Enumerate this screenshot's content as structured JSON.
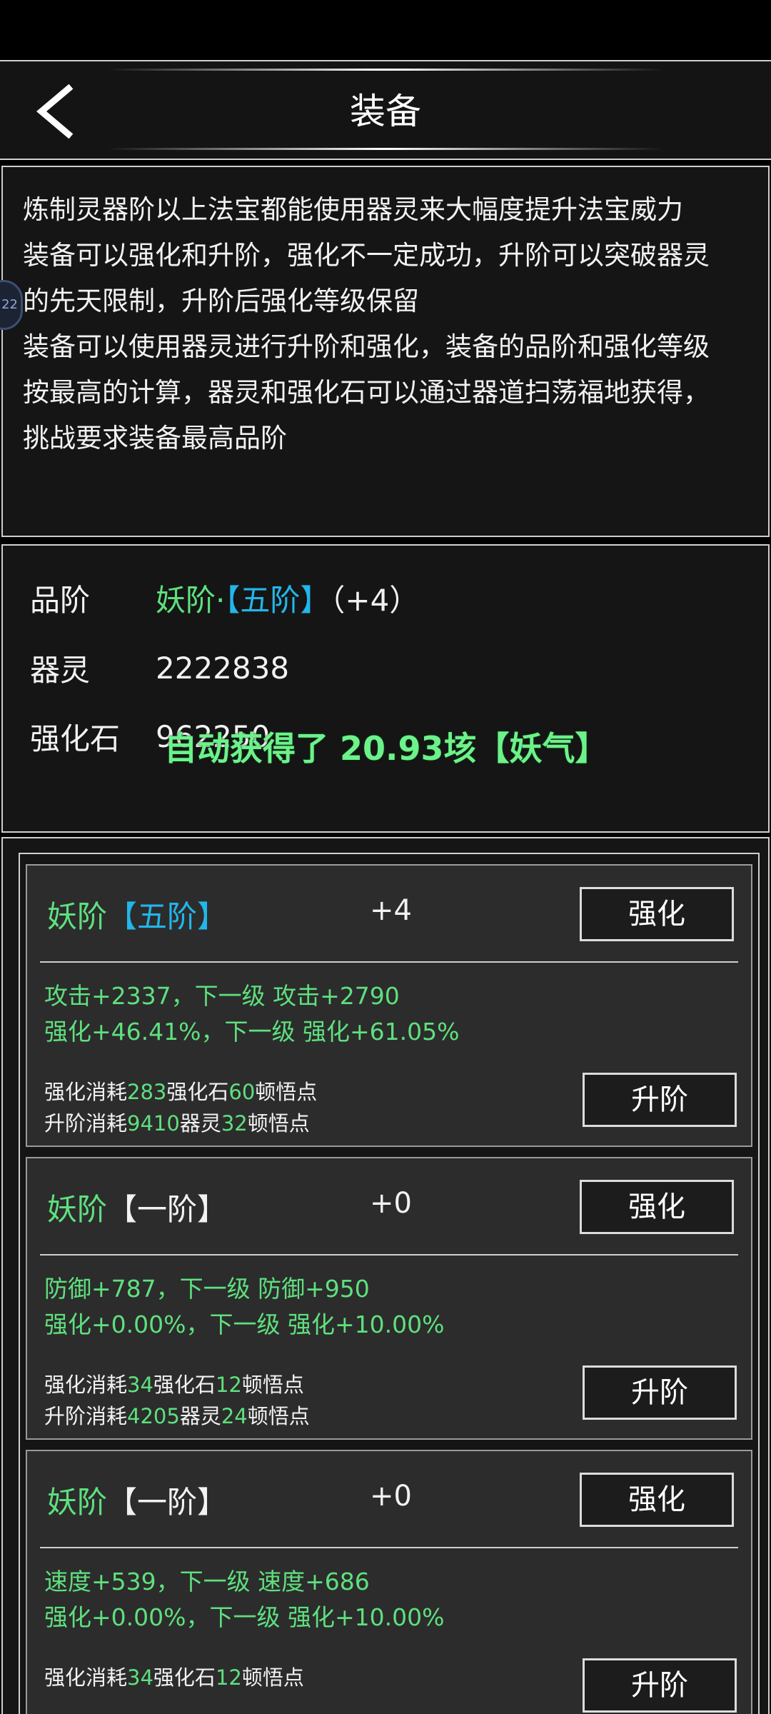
{
  "header": {
    "title": "装备"
  },
  "description": {
    "lines": [
      "炼制灵器阶以上法宝都能使用器灵来大幅度提升法宝威力",
      "装备可以强化和升阶，强化不一定成功，升阶可以突破器灵",
      "的先天限制，升阶后强化等级保留",
      "装备可以使用器灵进行升阶和强化，装备的品阶和强化等级",
      "按最高的计算，器灵和强化石可以通过器道扫荡福地获得，",
      "挑战要求装备最高品阶"
    ]
  },
  "side_badge": {
    "text": "22"
  },
  "stats": {
    "grade_label": "品阶",
    "grade_realm": "妖阶·",
    "grade_tier": "【五阶】",
    "grade_plus": "（+4）",
    "spirit_label": "器灵",
    "spirit_value": "2222838",
    "stone_label": "强化石",
    "stone_value": "962250"
  },
  "toast": {
    "text": "自动获得了 20.93垓【妖气】"
  },
  "cards": [
    {
      "realm": "妖阶",
      "tier": "【五阶】",
      "level": "+4",
      "strengthen_label": "强化",
      "ascend_label": "升阶",
      "attr1": "攻击+2337，下一级 攻击+2790",
      "attr2": "强化+46.41%，下一级 强化+61.05%",
      "cost1": {
        "prefix": "强化消耗",
        "n1": "283",
        "mid": "强化石",
        "n2": "60",
        "suffix": "顿悟点"
      },
      "cost2": {
        "prefix": "升阶消耗",
        "n1": "9410",
        "mid": "器灵",
        "n2": "32",
        "suffix": "顿悟点"
      }
    },
    {
      "realm": "妖阶",
      "tier": "【一阶】",
      "level": "+0",
      "strengthen_label": "强化",
      "ascend_label": "升阶",
      "attr1": "防御+787，下一级 防御+950",
      "attr2": "强化+0.00%，下一级 强化+10.00%",
      "cost1": {
        "prefix": "强化消耗",
        "n1": "34",
        "mid": "强化石",
        "n2": "12",
        "suffix": "顿悟点"
      },
      "cost2": {
        "prefix": "升阶消耗",
        "n1": "4205",
        "mid": "器灵",
        "n2": "24",
        "suffix": "顿悟点"
      }
    },
    {
      "realm": "妖阶",
      "tier": "【一阶】",
      "level": "+0",
      "strengthen_label": "强化",
      "ascend_label": "升阶",
      "attr1": "速度+539，下一级 速度+686",
      "attr2": "强化+0.00%，下一级 强化+10.00%",
      "cost1": {
        "prefix": "强化消耗",
        "n1": "34",
        "mid": "强化石",
        "n2": "12",
        "suffix": "顿悟点"
      }
    }
  ]
}
